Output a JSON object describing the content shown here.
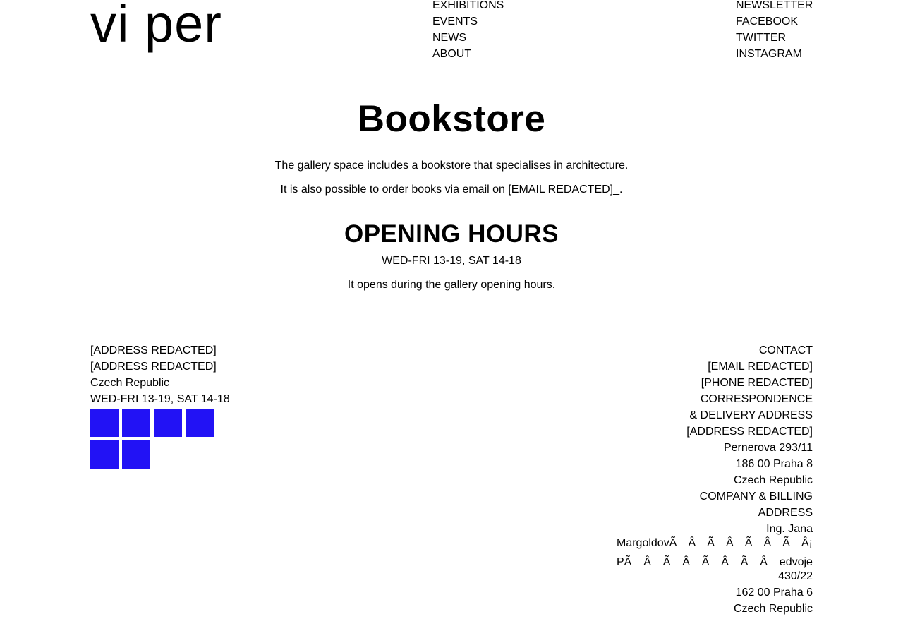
{
  "header": {
    "logo": "vi per",
    "nav_main": [
      "EXHIBITIONS",
      "EVENTS",
      "NEWS",
      "ABOUT"
    ],
    "nav_social": [
      "NEWSLETTER",
      "FACEBOOK",
      "TWITTER",
      "INSTAGRAM"
    ]
  },
  "main": {
    "title": "Bookstore",
    "intro": [
      "The gallery space includes a bookstore that specialises in architecture.",
      "It is also possible to order books via email on [EMAIL REDACTED]_."
    ],
    "hours_title": "OPENING HOURS",
    "hours": [
      "WED-FRI 13-19, SAT 14-18",
      "It opens during the gallery opening hours."
    ]
  },
  "footer": {
    "left_lines": [
      "[ADDRESS REDACTED]",
      "[ADDRESS REDACTED]",
      "Czech Republic",
      "WED-FRI 13-19, SAT 14-18"
    ],
    "social_icons": [
      "social-icon-1",
      "social-icon-2",
      "social-icon-3",
      "social-icon-4",
      "social-icon-5",
      "social-icon-6"
    ],
    "icon_color": "#2212f5",
    "right_lines_top": [
      "CONTACT",
      "[EMAIL REDACTED]",
      "[PHONE REDACTED]",
      "CORRESPONDENCE",
      "& DELIVERY ADDRESS",
      "[ADDRESS REDACTED]",
      "Pernerova 293/11",
      "186 00 Praha 8",
      "Czech Republic",
      "COMPANY & BILLING",
      "ADDRESS",
      "Ing. Jana"
    ],
    "garbled_line_1": [
      "MargoldovÃ",
      "Â",
      "Ã",
      "Â",
      "Ã",
      "Â",
      "Ã",
      "Â¡"
    ],
    "garbled_line_2": [
      "PÃ",
      "Â",
      "Ã",
      "Â",
      "Ã",
      "Â",
      "Ã",
      "Â",
      "edvoje"
    ],
    "right_lines_bottom": [
      "430/22",
      "162 00 Praha 6",
      "Czech Republic"
    ]
  }
}
